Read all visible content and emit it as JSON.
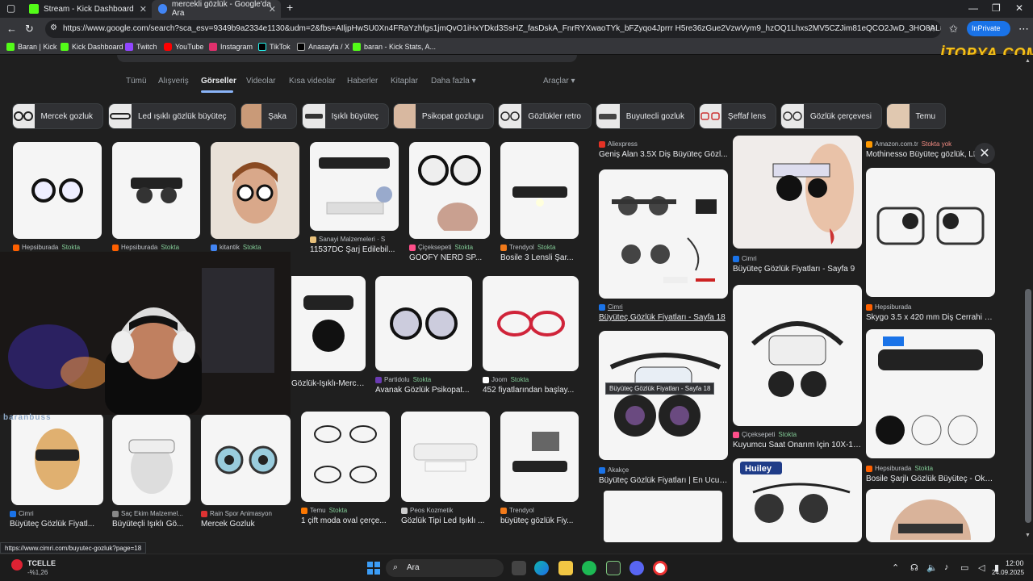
{
  "browser": {
    "tabs": [
      {
        "title": "Stream - Kick Dashboard",
        "favicon_color": "#53fc18"
      },
      {
        "title": "mercekli gözlük - Google'da Ara",
        "favicon_color": "#4285f4"
      }
    ],
    "new_tab": "+",
    "url": "https://www.google.com/search?sca_esv=9349b9a2334e1130&udm=2&fbs=AIljpHwSU0Xn4FRaYzhfgs1jmQvO1iHxYDkd3SsHZ_fasDskA_FnrRYXwaoTYk_bFZyqo4Jprrr H5re36zGue2VzwVym9_hzOQ1Lhxs2MV5CZJim81eQCO2JwD_3HO8ALtn-ORgU6yq4SqQbZk...",
    "inprivate_label": "InPrivate",
    "bookmarks": [
      "Baran | Kick",
      "Kick Dashboard",
      "Twitch",
      "YouTube",
      "Instagram",
      "TikTok",
      "Anasayfa / X",
      "baran - Kick Stats, A..."
    ]
  },
  "watermark": "İTOPYA.COM",
  "search_tabs": {
    "items": [
      "Tümü",
      "Alışveriş",
      "Görseller",
      "Videolar",
      "Kısa videolar",
      "Haberler",
      "Kitaplar"
    ],
    "more": "Daha fazla",
    "tools": "Araçlar",
    "selected": "Görseller"
  },
  "chips": [
    "Mercek gozluk",
    "Led ışıklı gözlük büyüteç",
    "Şaka",
    "Işıklı büyüteç",
    "Psikopat gozlugu",
    "Gözlükler retro",
    "Buyutecli gozluk",
    "Şeffaf lens",
    "Gözlük çerçevesi",
    "Temu"
  ],
  "results": {
    "row1": [
      {
        "source": "Hepsiburada",
        "stock": "Stokta",
        "title": ""
      },
      {
        "source": "Hepsiburada",
        "stock": "Stokta",
        "title": ""
      },
      {
        "source": "kitantik",
        "stock": "Stokta",
        "title": ""
      },
      {
        "source": "Sanayi Malzemeleri · S",
        "stock": "",
        "title": "11537DC Şarj Edilebil..."
      },
      {
        "source": "Çiçeksepeti",
        "stock": "Stokta",
        "title": "GOOFY NERD SP..."
      },
      {
        "source": "Trendyol",
        "stock": "Stokta",
        "title": "Bosile 3 Lensli Şar..."
      }
    ],
    "row2": [
      {
        "source": "",
        "stock": "",
        "title": "Gözlük-Işıklı-Mercekli"
      },
      {
        "source": "Partidolu",
        "stock": "Stokta",
        "title": "Avanak Gözlük Psikopat..."
      },
      {
        "source": "Joom",
        "stock": "Stokta",
        "title": "452 fiyatlarından başlay..."
      }
    ],
    "row3": [
      {
        "source": "Cimri",
        "stock": "",
        "title": "Büyüteç Gözlük Fiyatl..."
      },
      {
        "source": "Saç Ekim Malzemel...",
        "stock": "",
        "title": "Büyüteçli Işıklı Gö..."
      },
      {
        "source": "Rain Spor Animasyon",
        "stock": "",
        "title": "Mercek Gozluk"
      },
      {
        "source": "Temu",
        "stock": "Stokta",
        "title": "1 çift moda oval çerçe..."
      },
      {
        "source": "Peos Kozmetik",
        "stock": "",
        "title": "Gözlük Tipi Led Işıklı ..."
      },
      {
        "source": "Trendyol",
        "stock": "",
        "title": "büyüteç gözlük Fiy..."
      }
    ]
  },
  "overlay_name": "baranbuss",
  "side_panel": {
    "col1": [
      {
        "source": "Aliexpress",
        "stock": "",
        "title": "Geniş Alan 3.5X Diş Büyüteç Gözl..."
      },
      {
        "source": "Cimri",
        "stock": "",
        "title": "Büyüteç Gözlük Fiyatları - Sayfa 18"
      },
      {
        "source": "Akakçe",
        "stock": "",
        "title": "Büyüteç Gözlük Fiyatları | En Ucuz..."
      }
    ],
    "col2": [
      {
        "source": "Cimri",
        "stock": "",
        "title": "Büyüteç Gözlük Fiyatları - Sayfa 9"
      },
      {
        "source": "Çiçeksepeti",
        "stock": "Stokta",
        "title": "Kuyumcu Saat Onarım İçin 10X-15..."
      }
    ],
    "col3": [
      {
        "source": "Amazon.com.tr",
        "stock": "Stokta yok",
        "title": "Mothinesso Büyüteç gözlük, LED..."
      },
      {
        "source": "Hepsiburada",
        "stock": "",
        "title": "Skygo 3.5 x 420 mm Diş Cerrahi G..."
      },
      {
        "source": "Hepsiburada",
        "stock": "Stokta",
        "title": "Bosile Şarjlı Gözlük Büyüteç - Okul..."
      }
    ],
    "tooltip": "Büyüteç Gözlük Fiyatları - Sayfa 18",
    "close": "✕",
    "brand_label": "Huiley"
  },
  "status_url": "https://www.cimri.com/buyutec-gozluk?page=18",
  "taskbar": {
    "stock_name": "TCELLE",
    "stock_change": "-%1,26",
    "search": "Ara",
    "time": "12:00",
    "date": "24.09.2025"
  }
}
